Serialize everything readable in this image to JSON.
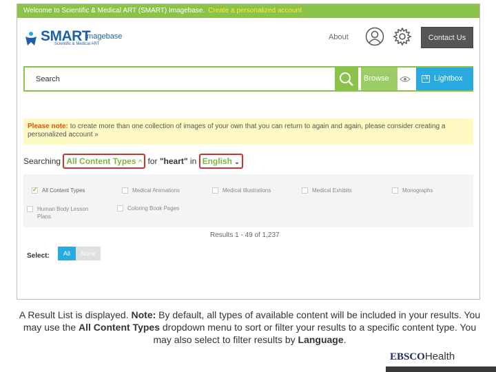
{
  "header": {
    "welcome_text": "Welcome to Scientific & Medical ART (SMART) Imagebase.",
    "create_account_link": "Create a personalized account",
    "logo_smart": "SMART",
    "logo_imagebase": "Imagebase",
    "logo_sub": "Scientific & Medical ART",
    "about_label": "About",
    "contact_label": "Contact Us"
  },
  "search": {
    "placeholder": "Search",
    "browse_label": "Browse",
    "lightbox_label": "Lightbox",
    "lightbox_badge": "LB"
  },
  "note": {
    "bold": "Please note:",
    "text": " to create more than one collection of images of your own that you can return to again and again, please consider creating a personalized account »"
  },
  "searching": {
    "prefix": "Searching",
    "content_type": "All Content Types",
    "for_text": "for",
    "term": "\"heart\"",
    "in_text": "in",
    "language": "English"
  },
  "content_types": [
    {
      "label": "All Content Types",
      "checked": true
    },
    {
      "label": "Medical Animations",
      "checked": false
    },
    {
      "label": "Medical Illustrations",
      "checked": false
    },
    {
      "label": "Medical Exhibits",
      "checked": false
    },
    {
      "label": "Monographs",
      "checked": false
    },
    {
      "label": "Human Body Lesson Plans",
      "checked": false
    },
    {
      "label": "Coloring Book Pages",
      "checked": false
    }
  ],
  "results": {
    "count_text": "Results 1 - 49 of 1,237"
  },
  "select": {
    "label": "Select:",
    "all": "All",
    "none": "None"
  },
  "caption": {
    "part1": "A Result List is displayed. ",
    "note_bold": "Note:",
    "part2": " By default, all types of available content will be included in your results. You may use the ",
    "bold2": "All Content Types",
    "part3": " dropdown menu to sort or filter your results to a specific content type. You may also select to filter results by ",
    "bold3": "Language",
    "part4": "."
  },
  "footer": {
    "brand": "EBSCO",
    "health": "Health"
  },
  "colors": {
    "accent_green": "#8bc34a",
    "accent_blue": "#29abe2",
    "highlight_red": "#d32f2f"
  }
}
